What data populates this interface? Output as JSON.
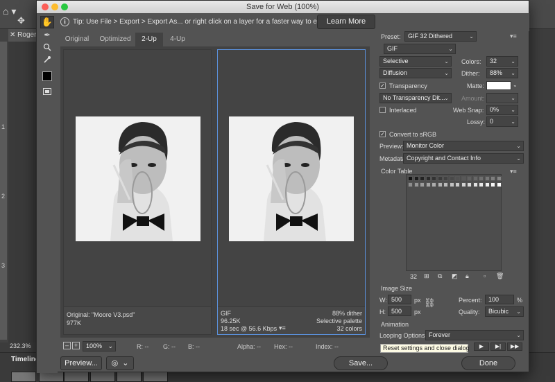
{
  "background": {
    "tab_label": "Roger",
    "ruler_marks": [
      "1",
      "2",
      "3"
    ],
    "zoom": "232.3%",
    "timeline_label": "Timeline"
  },
  "dialog": {
    "title": "Save for Web (100%)",
    "tip": {
      "text": "Tip: Use File > Export > Export As...   or right click on a layer for a faster way to export assets",
      "learn_more": "Learn More"
    },
    "view_tabs": [
      "Original",
      "Optimized",
      "2-Up",
      "4-Up"
    ],
    "active_tab": "2-Up",
    "left_pane": {
      "line1": "Original: \"Moore V3.psd\"",
      "line2": "977K"
    },
    "right_pane": {
      "format": "GIF",
      "size": "96.25K",
      "time": "18 sec @ 56.6 Kbps",
      "dither": "88% dither",
      "palette": "Selective palette",
      "colors": "32 colors"
    },
    "status": {
      "zoom": "100%",
      "r": "R: --",
      "g": "G: --",
      "b": "B: --",
      "alpha": "Alpha: --",
      "hex": "Hex: --",
      "index": "Index: --"
    },
    "footer": {
      "preview": "Preview...",
      "save": "Save...",
      "done": "Done",
      "tooltip": "Reset settings and close dialog"
    },
    "settings": {
      "preset_label": "Preset:",
      "preset_value": "GIF 32 Dithered",
      "format": "GIF",
      "reduction": "Selective",
      "dither_algo": "Diffusion",
      "colors_label": "Colors:",
      "colors_value": "32",
      "dither_label": "Dither:",
      "dither_value": "88%",
      "transparency_label": "Transparency",
      "matte_label": "Matte:",
      "transparency_dither": "No Transparency Dit...",
      "amount_label": "Amount:",
      "interlaced_label": "Interlaced",
      "websnap_label": "Web Snap:",
      "websnap_value": "0%",
      "lossy_label": "Lossy:",
      "lossy_value": "0",
      "convert_srgb_label": "Convert to sRGB",
      "preview_label": "Preview:",
      "preview_value": "Monitor Color",
      "metadata_label": "Metadata:",
      "metadata_value": "Copyright and Contact Info",
      "color_table_label": "Color Table",
      "color_count": "32",
      "image_size_label": "Image Size",
      "w_label": "W:",
      "w_value": "500",
      "h_label": "H:",
      "h_value": "500",
      "px": "px",
      "percent_label": "Percent:",
      "percent_value": "100",
      "percent_unit": "%",
      "quality_label": "Quality:",
      "quality_value": "Bicubic",
      "animation_label": "Animation",
      "looping_label": "Looping Options:",
      "looping_value": "Forever"
    },
    "colors": {
      "accent_blue": "#5a8fd8",
      "matte_color": "#ffffff"
    }
  }
}
